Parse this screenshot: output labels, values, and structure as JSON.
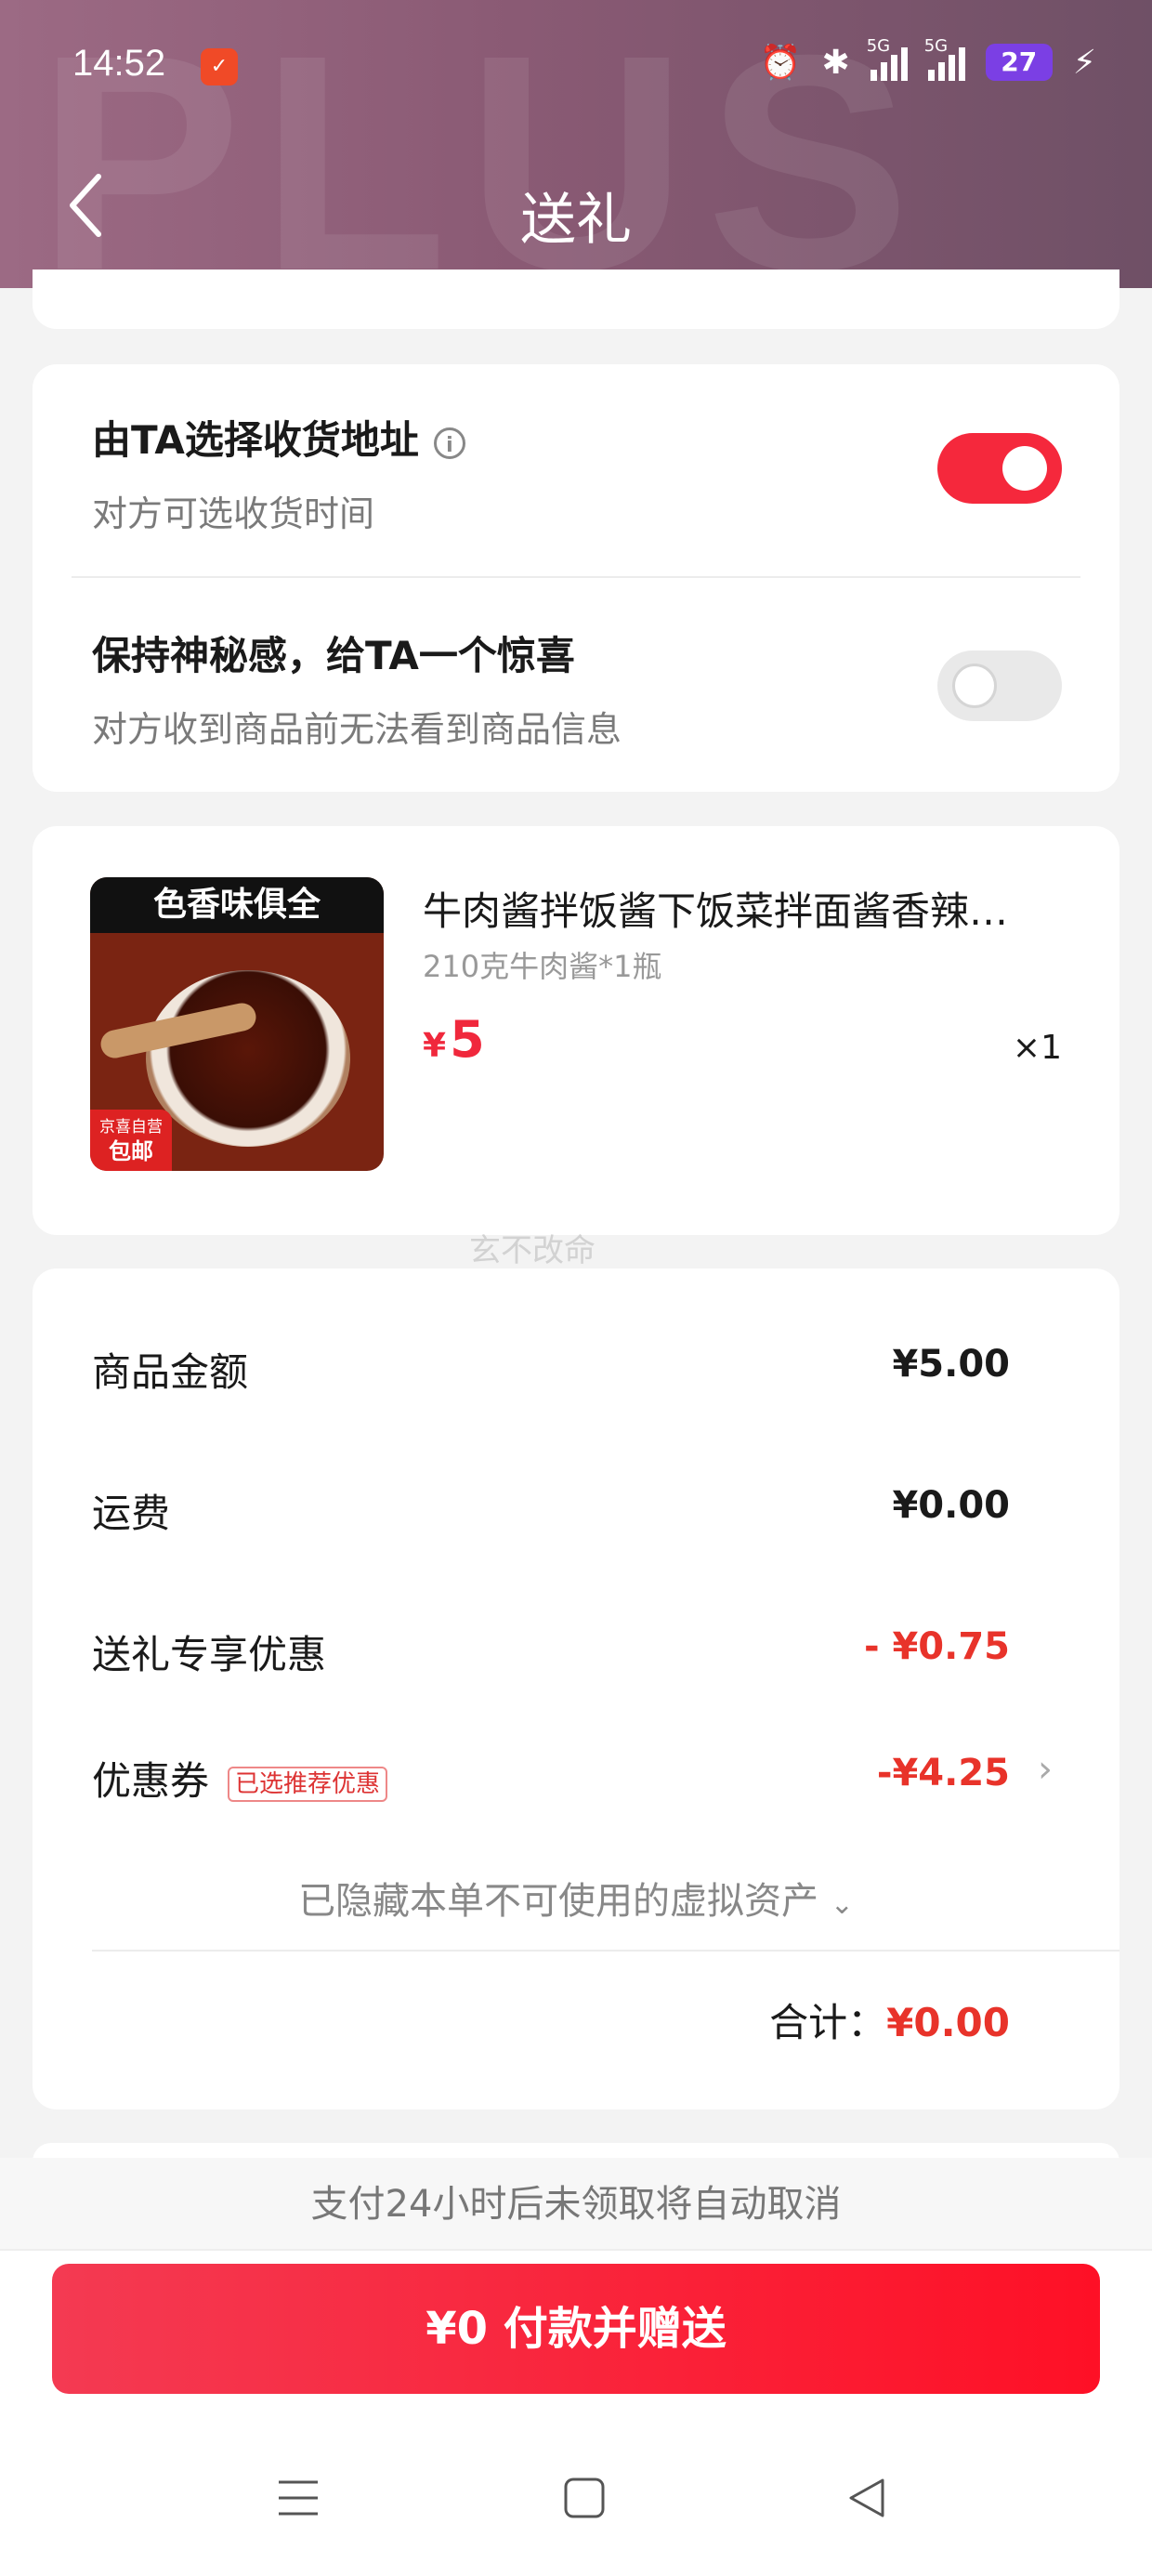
{
  "status_bar": {
    "time": "14:52",
    "network_1": "5G",
    "network_2": "5G",
    "battery": "27"
  },
  "header": {
    "title": "送礼",
    "background_text": "PLUS"
  },
  "options": {
    "recipient_address": {
      "title": "由TA选择收货地址",
      "subtitle": "对方可选收货时间",
      "enabled": true
    },
    "mystery": {
      "title": "保持神秘感，给TA一个惊喜",
      "subtitle": "对方收到商品前无法看到商品信息",
      "enabled": false
    }
  },
  "product": {
    "image_banner": "色香味俱全",
    "image_badge_top": "京喜自营",
    "image_badge_bottom": "包邮",
    "name": "牛肉酱拌饭酱下饭菜拌面酱香辣…",
    "spec": "210克牛肉酱*1瓶",
    "currency": "¥",
    "price": "5",
    "quantity": "×1"
  },
  "watermark": "玄不改命",
  "summary": {
    "goods_amount": {
      "label": "商品金额",
      "value": "¥5.00"
    },
    "shipping": {
      "label": "运费",
      "value": "¥0.00"
    },
    "gift_discount": {
      "label": "送礼专享优惠",
      "value": "- ¥0.75"
    },
    "coupon": {
      "label": "优惠券",
      "tag": "已选推荐优惠",
      "value": "-¥4.25"
    },
    "hidden_assets": "已隐藏本单不可使用的虚拟资产",
    "total_label": "合计：",
    "total_value": "¥0.00"
  },
  "footer": {
    "notice": "支付24小时后未领取将自动取消",
    "pay_button": "¥0 付款并赠送"
  },
  "colors": {
    "accent": "#f5283c",
    "price_red": "#e8332a",
    "header": "#8a5a74"
  }
}
